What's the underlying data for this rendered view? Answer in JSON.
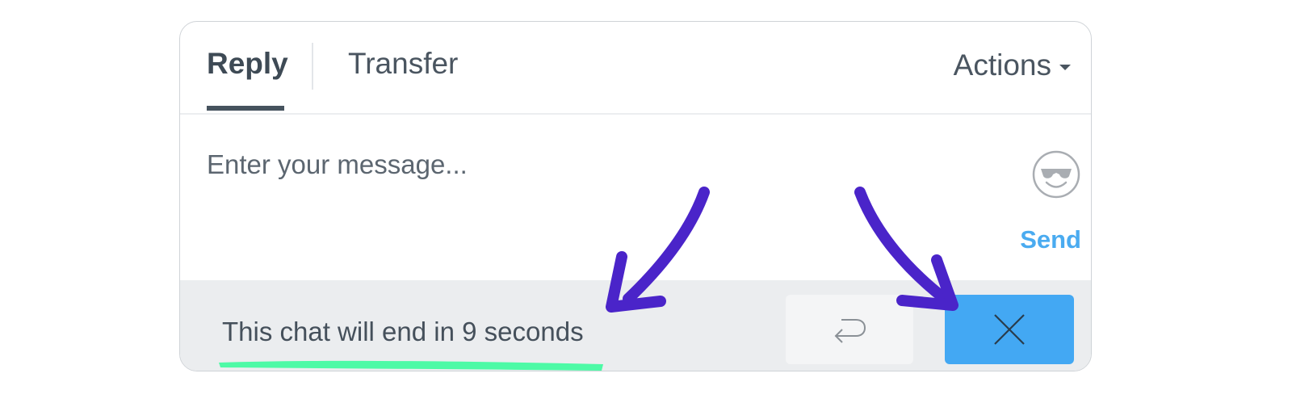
{
  "tabs": [
    {
      "label": "Reply",
      "active": true
    },
    {
      "label": "Transfer",
      "active": false
    }
  ],
  "actions_label": "Actions",
  "composer": {
    "placeholder": "Enter your message...",
    "value": "",
    "send_label": "Send"
  },
  "footer": {
    "countdown_text": "This chat will end in 9 seconds"
  },
  "icons": {
    "emoji": "emoji-sunglasses-icon",
    "undo": "return-arrow-icon",
    "close": "close-x-icon",
    "actions_caret": "caret-down-icon"
  },
  "colors": {
    "accent_blue": "#43a8f3",
    "send_blue": "#4aabf0",
    "annotation_purple": "#4a24c9",
    "highlight_green": "#4dfaa6",
    "text_dark": "#4a5560"
  }
}
